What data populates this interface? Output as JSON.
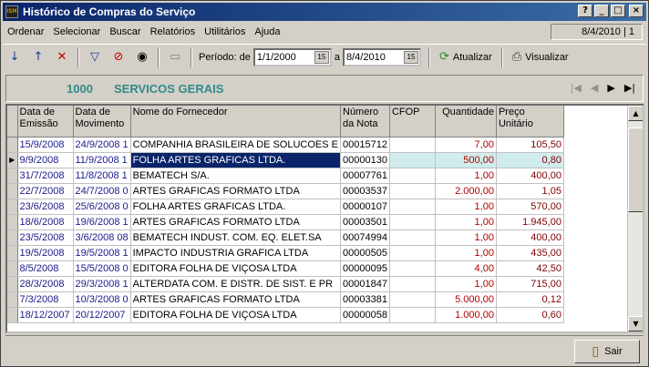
{
  "window": {
    "title": "Histórico de Compras do Serviço",
    "app_icon": "ISM"
  },
  "menu": {
    "items": [
      "Ordenar",
      "Selecionar",
      "Buscar",
      "Relatórios",
      "Utilitários",
      "Ajuda"
    ],
    "status": "8/4/2010 | 1"
  },
  "toolbar": {
    "period_label": "Período: de",
    "date_from": "1/1/2000",
    "date_to_label": "a",
    "date_to": "8/4/2010",
    "calendar_icon": "15",
    "refresh_label": "Atualizar",
    "view_label": "Visualizar"
  },
  "header": {
    "code": "1000",
    "department": "SERVICOS GERAIS"
  },
  "grid": {
    "columns": [
      "Data de Emissão",
      "Data de Movimento",
      "Nome do Fornecedor",
      "Número da Nota",
      "CFOP",
      "Quantidade",
      "Preço Unitário"
    ],
    "rows": [
      {
        "emissao": "15/9/2008",
        "movimento": "24/9/2008 1",
        "fornecedor": "COMPANHIA BRASILEIRA DE SOLUCOES E",
        "nota": "00015712",
        "cfop": "",
        "qtd": "7,00",
        "preco": "105,50"
      },
      {
        "emissao": "9/9/2008",
        "movimento": "11/9/2008 1",
        "fornecedor": "FOLHA ARTES GRAFICAS LTDA.",
        "nota": "00000130",
        "cfop": "",
        "qtd": "500,00",
        "preco": "0,80",
        "selected": true
      },
      {
        "emissao": "31/7/2008",
        "movimento": "11/8/2008 1",
        "fornecedor": "BEMATECH S/A.",
        "nota": "00007761",
        "cfop": "",
        "qtd": "1,00",
        "preco": "400,00"
      },
      {
        "emissao": "22/7/2008",
        "movimento": "24/7/2008 0",
        "fornecedor": "ARTES GRAFICAS FORMATO LTDA",
        "nota": "00003537",
        "cfop": "",
        "qtd": "2.000,00",
        "preco": "1,05"
      },
      {
        "emissao": "23/6/2008",
        "movimento": "25/6/2008 0",
        "fornecedor": "FOLHA ARTES GRAFICAS LTDA.",
        "nota": "00000107",
        "cfop": "",
        "qtd": "1,00",
        "preco": "570,00"
      },
      {
        "emissao": "18/6/2008",
        "movimento": "19/6/2008 1",
        "fornecedor": "ARTES GRAFICAS FORMATO LTDA",
        "nota": "00003501",
        "cfop": "",
        "qtd": "1,00",
        "preco": "1.945,00"
      },
      {
        "emissao": "23/5/2008",
        "movimento": "3/6/2008 08",
        "fornecedor": "BEMATECH INDUST. COM. EQ.  ELET.SA",
        "nota": "00074994",
        "cfop": "",
        "qtd": "1,00",
        "preco": "400,00"
      },
      {
        "emissao": "19/5/2008",
        "movimento": "19/5/2008 1",
        "fornecedor": "IMPACTO INDUSTRIA GRAFICA LTDA",
        "nota": "00000505",
        "cfop": "",
        "qtd": "1,00",
        "preco": "435,00"
      },
      {
        "emissao": "8/5/2008",
        "movimento": "15/5/2008 0",
        "fornecedor": "EDITORA FOLHA DE VIÇOSA LTDA",
        "nota": "00000095",
        "cfop": "",
        "qtd": "4,00",
        "preco": "42,50"
      },
      {
        "emissao": "28/3/2008",
        "movimento": "29/3/2008 1",
        "fornecedor": "ALTERDATA COM. E DISTR. DE SIST. E PR",
        "nota": "00001847",
        "cfop": "",
        "qtd": "1,00",
        "preco": "715,00"
      },
      {
        "emissao": "7/3/2008",
        "movimento": "10/3/2008 0",
        "fornecedor": "ARTES GRAFICAS FORMATO LTDA",
        "nota": "00003381",
        "cfop": "",
        "qtd": "5.000,00",
        "preco": "0,12"
      },
      {
        "emissao": "18/12/2007",
        "movimento": "20/12/2007",
        "fornecedor": "EDITORA FOLHA DE VIÇOSA LTDA",
        "nota": "00000058",
        "cfop": "",
        "qtd": "1.000,00",
        "preco": "0,60"
      }
    ]
  },
  "footer": {
    "exit_label": "Sair"
  }
}
